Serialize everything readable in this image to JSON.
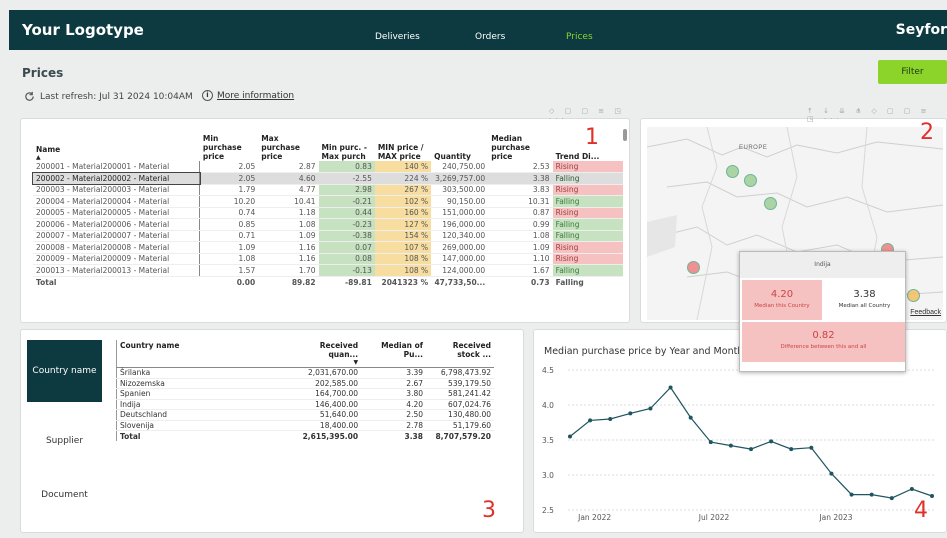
{
  "app": {
    "logo": "Your Logotype",
    "brand": "Seyfor",
    "nav_tabs": [
      "Deliveries",
      "Orders",
      "Prices"
    ],
    "active_tab": "Prices"
  },
  "page": {
    "title": "Prices",
    "filter_label": "Filter",
    "refresh_text": "Last refresh: Jul 31 2024 10:04AM",
    "more_info": "More information"
  },
  "markers": [
    "1",
    "2",
    "3",
    "4"
  ],
  "price_table": {
    "headers": [
      "Name",
      "Min purchase price",
      "Max purchase price",
      "Min purc. - Max purch",
      "MIN price / MAX price",
      "Quantity",
      "Median purchase price",
      "Trend Di..."
    ],
    "rows": [
      [
        "200001 - Material200001 - Material",
        "2.05",
        "2.87",
        "0.83",
        "140 %",
        "240,750.00",
        "2.53",
        "Rising"
      ],
      [
        "200002 - Material200002 - Material",
        "2.05",
        "4.60",
        "-2.55",
        "224 %",
        "3,269,757.00",
        "3.38",
        "Falling"
      ],
      [
        "200003 - Material200003 - Material",
        "1.79",
        "4.77",
        "2.98",
        "267 %",
        "303,500.00",
        "3.83",
        "Rising"
      ],
      [
        "200004 - Material200004 - Material",
        "10.20",
        "10.41",
        "-0.21",
        "102 %",
        "90,150.00",
        "10.31",
        "Falling"
      ],
      [
        "200005 - Material200005 - Material",
        "0.74",
        "1.18",
        "0.44",
        "160 %",
        "151,000.00",
        "0.87",
        "Rising"
      ],
      [
        "200006 - Material200006 - Material",
        "0.85",
        "1.08",
        "-0.23",
        "127 %",
        "196,000.00",
        "0.99",
        "Falling"
      ],
      [
        "200007 - Material200007 - Material",
        "0.71",
        "1.09",
        "-0.38",
        "154 %",
        "120,340.00",
        "1.08",
        "Falling"
      ],
      [
        "200008 - Material200008 - Material",
        "1.09",
        "1.16",
        "0.07",
        "107 %",
        "269,000.00",
        "1.09",
        "Rising"
      ],
      [
        "200009 - Material200009 - Material",
        "1.08",
        "1.16",
        "0.08",
        "108 %",
        "147,000.00",
        "1.10",
        "Rising"
      ],
      [
        "200013 - Material200013 - Material",
        "1.57",
        "1.70",
        "-0.13",
        "108 %",
        "124,000.00",
        "1.67",
        "Falling"
      ]
    ],
    "total": [
      "Total",
      "0.00",
      "89.82",
      "-89.81",
      "2041323 %",
      "47,733,50...",
      "0.73",
      "Falling"
    ]
  },
  "map": {
    "label": "EUROPE",
    "feedback": "Feedback",
    "points": [
      {
        "lon": -3.7,
        "lat": 40.4,
        "color": "#f08080"
      },
      {
        "lon": 2.3,
        "lat": 48.8,
        "color": "#9fcf98"
      },
      {
        "lon": 5.0,
        "lat": 48.0,
        "color": "#9fcf98"
      },
      {
        "lon": 8.0,
        "lat": 46.0,
        "color": "#9fcf98"
      },
      {
        "lon": 26.0,
        "lat": 42.0,
        "color": "#f08080"
      },
      {
        "lon": 30.0,
        "lat": 38.0,
        "color": "#f2c060"
      }
    ]
  },
  "tooltip": {
    "country": "Indija",
    "this_value": "4.20",
    "this_label": "Median this Country",
    "all_value": "3.38",
    "all_label": "Median all Country",
    "diff_value": "0.82",
    "diff_label": "Difference between this and all"
  },
  "side_tabs": [
    "Country name",
    "Supplier",
    "Document"
  ],
  "country_table": {
    "headers": [
      "Country name",
      "Received quan...",
      "Median of Pu...",
      "Received stock ..."
    ],
    "rows": [
      [
        "Šrilanka",
        "2,031,670.00",
        "3.39",
        "6,798,473.92"
      ],
      [
        "Nizozemska",
        "202,585.00",
        "2.67",
        "539,179.50"
      ],
      [
        "Spanien",
        "164,700.00",
        "3.80",
        "581,241.42"
      ],
      [
        "Indija",
        "146,400.00",
        "4.20",
        "607,024.76"
      ],
      [
        "Deutschland",
        "51,640.00",
        "2.50",
        "130,480.00"
      ],
      [
        "Slovenija",
        "18,400.00",
        "2.78",
        "51,179.60"
      ]
    ],
    "total": [
      "Total",
      "2,615,395.00",
      "3.38",
      "8,707,579.20"
    ]
  },
  "chart_data": {
    "type": "line",
    "title": "Median purchase price by Year and Month",
    "xlabel": "",
    "ylabel": "",
    "x_tick_labels": [
      "Jan 2022",
      "Jul 2022",
      "Jan 2023"
    ],
    "x_tick_index": [
      1,
      7,
      13
    ],
    "ylim": [
      2.5,
      4.5
    ],
    "y_ticks": [
      2.5,
      3.0,
      3.5,
      4.0,
      4.5
    ],
    "grid": true,
    "values": [
      3.55,
      3.78,
      3.8,
      3.88,
      3.95,
      4.25,
      3.82,
      3.47,
      3.42,
      3.37,
      3.48,
      3.37,
      3.39,
      3.02,
      2.72,
      2.72,
      2.67,
      2.8,
      2.7
    ],
    "color": "#1f5560"
  },
  "colors": {
    "nav_bg": "#0c3a40",
    "accent": "#8cd42a",
    "rising": "#f6c1c1",
    "falling": "#c6e2c0",
    "marker": "#e0302a"
  }
}
